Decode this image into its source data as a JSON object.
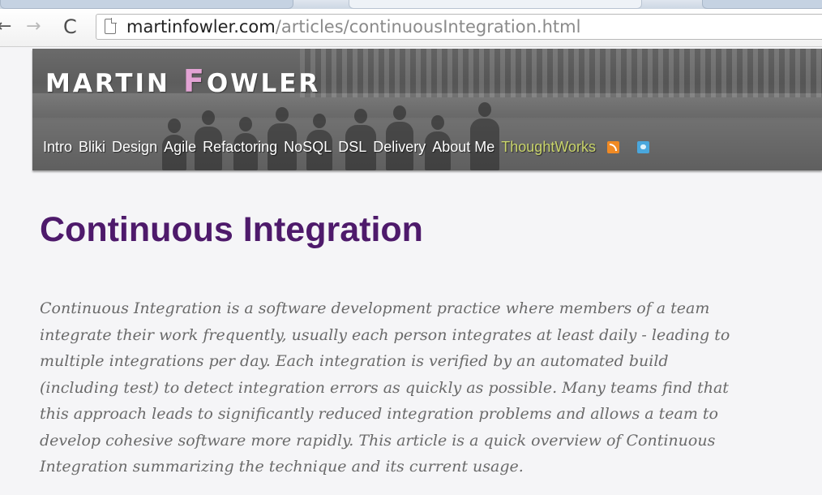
{
  "browser": {
    "url_domain": "martinfowler.com",
    "url_path": "/articles/continuousIntegration.html",
    "back_glyph": "←",
    "forward_glyph": "→",
    "reload_glyph": "C"
  },
  "site": {
    "logo_first": "MARTIN",
    "logo_initial": "F",
    "logo_rest": "OWLER",
    "nav": [
      {
        "label": "Intro"
      },
      {
        "label": "Bliki"
      },
      {
        "label": "Design"
      },
      {
        "label": "Agile"
      },
      {
        "label": "Refactoring"
      },
      {
        "label": "NoSQL"
      },
      {
        "label": "DSL"
      },
      {
        "label": "Delivery"
      },
      {
        "label": "About Me"
      },
      {
        "label": "ThoughtWorks"
      }
    ],
    "icons": [
      "rss-icon",
      "twitter-icon"
    ]
  },
  "article": {
    "title": "Continuous Integration",
    "abstract_lines": [
      "Continuous Integration is a software development practice where members of a team",
      "integrate their work frequently, usually each person integrates at least daily - leading to",
      "multiple integrations per day. Each integration is verified by an automated build",
      "(including test) to detect integration errors as quickly as possible. Many teams find that",
      "this approach leads to significantly reduced integration problems and allows a team to",
      "develop cohesive software more rapidly. This article is a quick overview of Continuous",
      "Integration summarizing the technique and its current usage."
    ]
  },
  "colors": {
    "title": "#4e1a6b",
    "thoughtworks_link": "#c9d46a",
    "abstract_text": "#6a6a6a"
  }
}
